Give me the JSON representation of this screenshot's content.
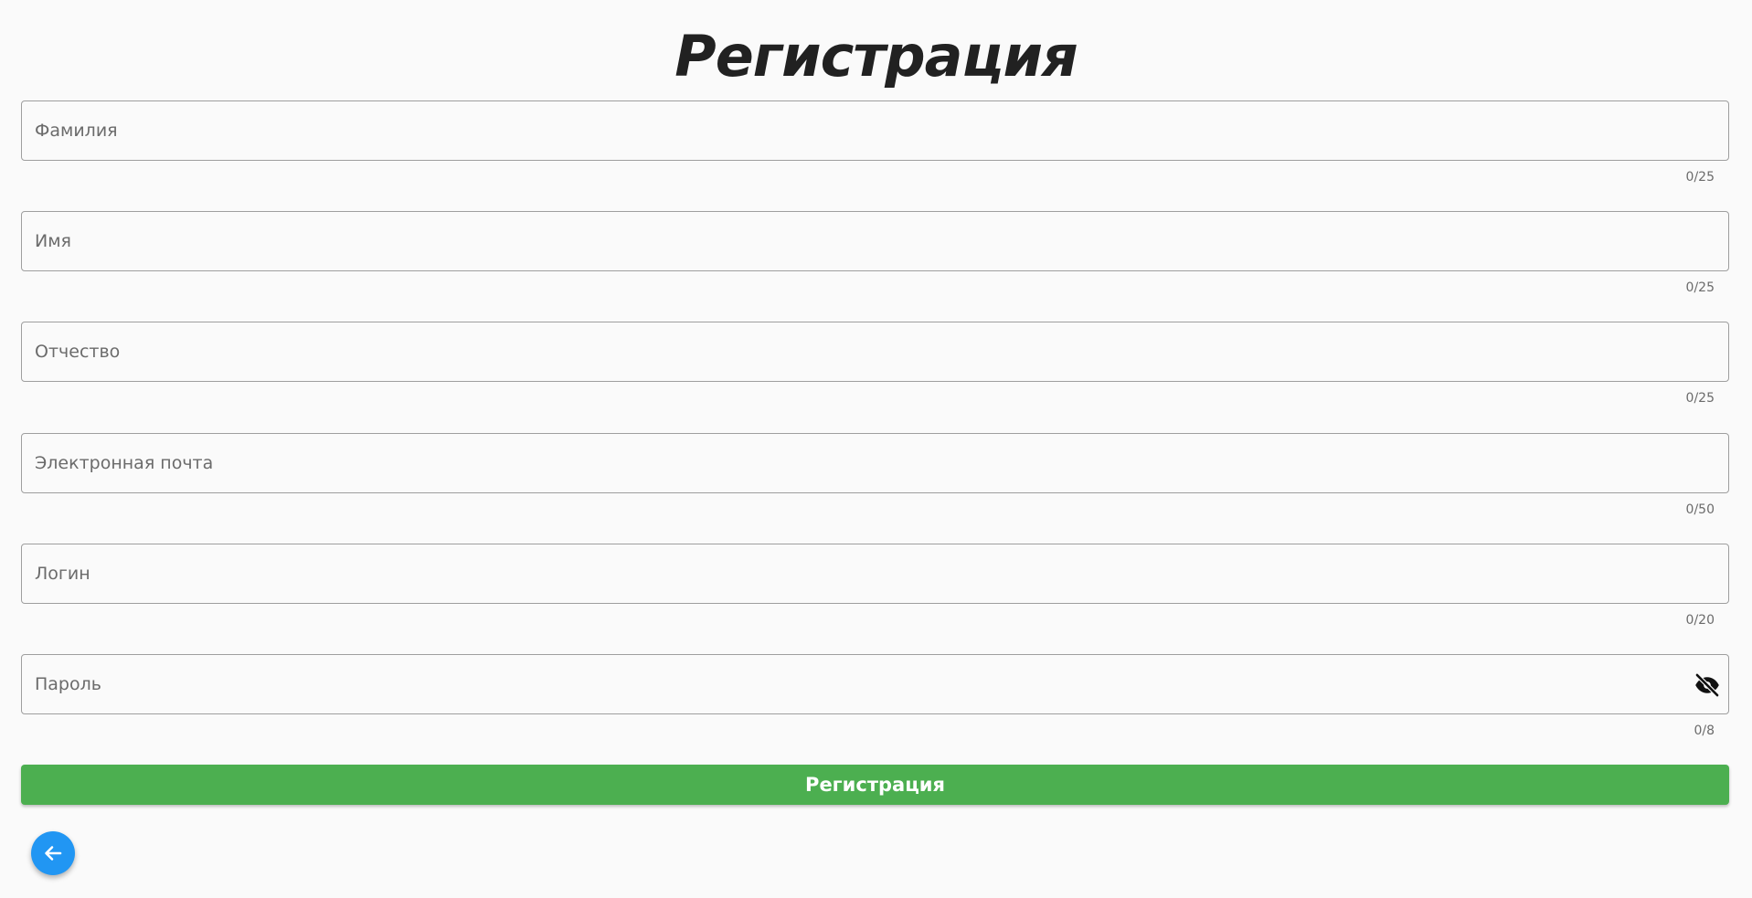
{
  "title": "Регистрация",
  "fields": [
    {
      "placeholder": "Фамилия",
      "counter": "0/25",
      "type": "text"
    },
    {
      "placeholder": "Имя",
      "counter": "0/25",
      "type": "text"
    },
    {
      "placeholder": "Отчество",
      "counter": "0/25",
      "type": "text"
    },
    {
      "placeholder": "Электронная почта",
      "counter": "0/50",
      "type": "email"
    },
    {
      "placeholder": "Логин",
      "counter": "0/20",
      "type": "text"
    },
    {
      "placeholder": "Пароль",
      "counter": "0/8",
      "type": "password"
    }
  ],
  "password_toggle_icon": "visibility-off-icon",
  "submit_label": "Регистрация",
  "back_icon": "arrow-left-icon",
  "colors": {
    "submit_button": "#4caf50",
    "back_button": "#2196f3",
    "background": "#fafafa",
    "field_border": "#9e9e9e"
  }
}
